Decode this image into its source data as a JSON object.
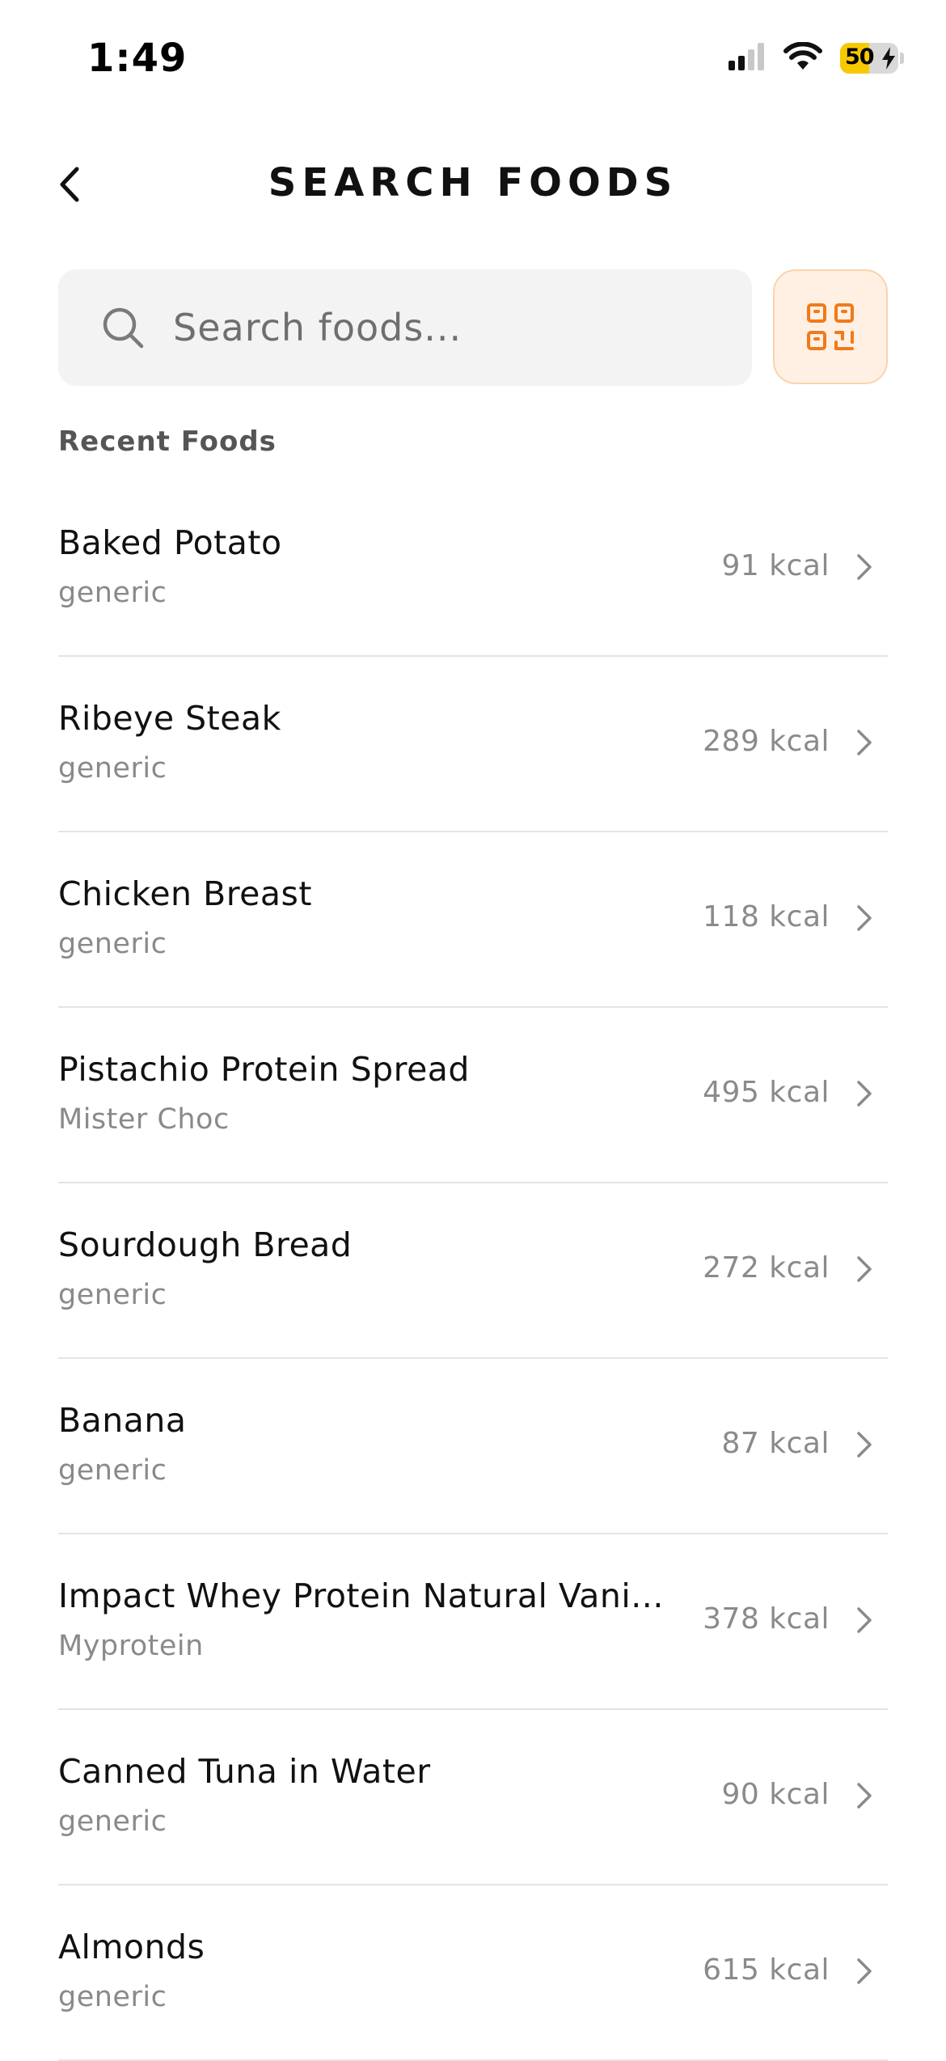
{
  "status_bar": {
    "time": "1:49",
    "battery_percent": "50",
    "battery_level": 0.5,
    "icons": [
      "cellular-signal-icon",
      "wifi-icon",
      "battery-charging-icon"
    ]
  },
  "header": {
    "title": "SEARCH FOODS",
    "back_icon": "chevron-left-icon"
  },
  "search": {
    "value": "",
    "placeholder": "Search foods...",
    "icon": "search-icon",
    "scan_icon": "barcode-scan-icon"
  },
  "recent": {
    "title": "Recent Foods",
    "items": [
      {
        "name": "Baked Potato",
        "brand": "generic",
        "kcal": "91 kcal"
      },
      {
        "name": "Ribeye Steak",
        "brand": "generic",
        "kcal": "289 kcal"
      },
      {
        "name": "Chicken Breast",
        "brand": "generic",
        "kcal": "118 kcal"
      },
      {
        "name": "Pistachio Protein Spread",
        "brand": "Mister Choc",
        "kcal": "495 kcal"
      },
      {
        "name": "Sourdough Bread",
        "brand": "generic",
        "kcal": "272 kcal"
      },
      {
        "name": "Banana",
        "brand": "generic",
        "kcal": "87 kcal"
      },
      {
        "name": "Impact Whey Protein Natural Vani...",
        "brand": "Myprotein",
        "kcal": "378 kcal"
      },
      {
        "name": "Canned Tuna in Water",
        "brand": "generic",
        "kcal": "90 kcal"
      },
      {
        "name": "Almonds",
        "brand": "generic",
        "kcal": "615 kcal"
      }
    ]
  },
  "colors": {
    "accent": "#f07a1a",
    "accent_bg": "#fff0e3",
    "battery": "#f7c900",
    "muted_text": "#8a8a8a",
    "divider": "#e4e4e4"
  }
}
